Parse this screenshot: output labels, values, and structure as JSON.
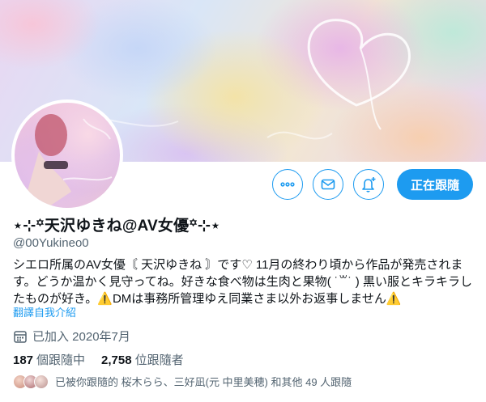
{
  "profile": {
    "name_prefix": "⋆⊹꙳",
    "display_name": "天沢ゆきね@AV女優",
    "name_suffix": "꙳⊹⋆",
    "handle": "@00Yukineo0",
    "bio_part1": "シエロ所属のAV女優〘 天沢ゆきね 〙です♡ 11月の終わり頃から作品が発売されます。どうか温かく見守ってね。好きな食べ物は生肉と果物( ˙꒳˙ ) 黒い服とキラキラしたものが好き。",
    "bio_warn_icon": "⚠️",
    "bio_part2": "DMは事務所管理ゆえ同業さま以外お返事しません",
    "translate_label": "翻譯自我介紹",
    "joined": "已加入 2020年7月",
    "following_count": "187",
    "following_label": "個跟隨中",
    "followers_count": "2,758",
    "followers_label": "位跟隨者",
    "followed_by": "已被你跟隨的 桜木らら、三好凪(元 中里美穂) 和其他 49 人跟隨"
  },
  "actions": {
    "more_icon": "more-icon",
    "message_icon": "envelope-icon",
    "notify_icon": "bell-plus-icon",
    "follow_label": "正在跟隨"
  },
  "colors": {
    "accent": "#1d9bf0",
    "secondary_text": "#536471",
    "primary_text": "#0f1419"
  }
}
